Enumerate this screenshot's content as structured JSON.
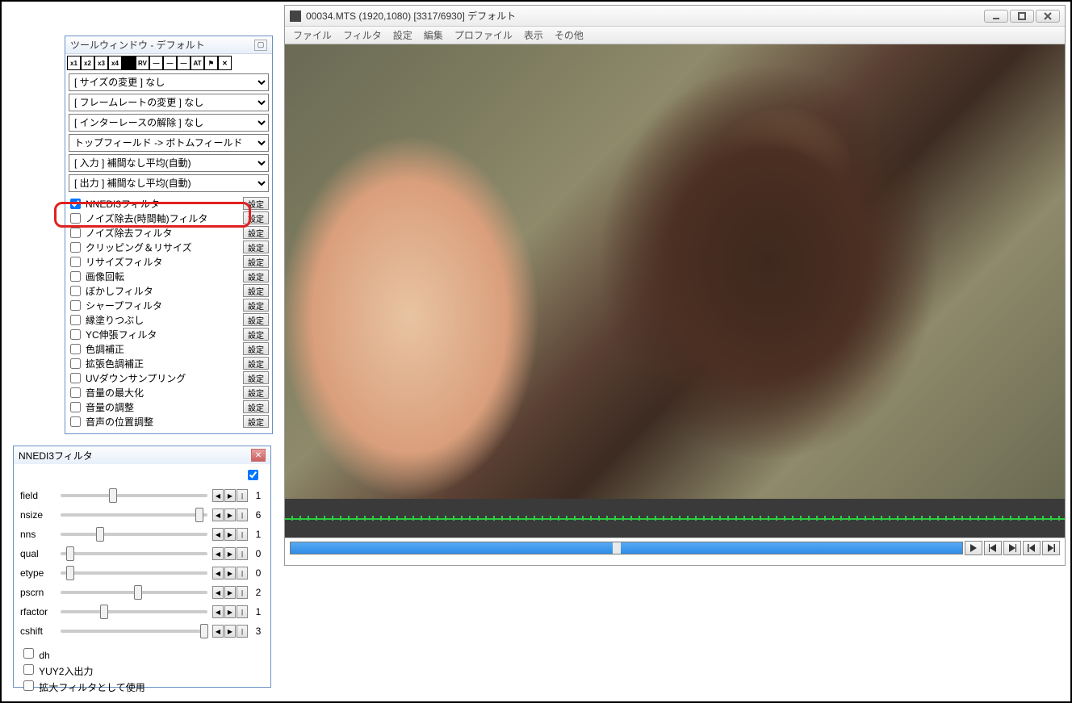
{
  "main": {
    "title": "00034.MTS (1920,1080) [3317/6930] デフォルト",
    "menu": [
      "ファイル",
      "フィルタ",
      "設定",
      "編集",
      "プロファイル",
      "表示",
      "その他"
    ]
  },
  "toolWindow": {
    "title": "ツールウィンドウ - デフォルト",
    "toolbar": [
      "x1",
      "x2",
      "x3",
      "x4",
      "",
      "RV",
      "—",
      "—",
      "—",
      "AT",
      "⚑",
      "✕"
    ],
    "selects": [
      {
        "value": "[ サイズの変更 ] なし"
      },
      {
        "value": "[ フレームレートの変更 ] なし"
      },
      {
        "value": "[ インターレースの解除 ] なし"
      },
      {
        "value": "トップフィールド -> ボトムフィールド"
      },
      {
        "value": "[ 入力 ] 補間なし平均(自動)"
      },
      {
        "value": "[ 出力 ] 補間なし平均(自動)"
      }
    ],
    "settings_label": "設定",
    "filters": [
      {
        "label": "NNEDI3フィルタ",
        "checked": true
      },
      {
        "label": "ノイズ除去(時間軸)フィルタ",
        "checked": false
      },
      {
        "label": "ノイズ除去フィルタ",
        "checked": false
      },
      {
        "label": "クリッピング＆リサイズ",
        "checked": false
      },
      {
        "label": "リサイズフィルタ",
        "checked": false
      },
      {
        "label": "画像回転",
        "checked": false
      },
      {
        "label": "ぼかしフィルタ",
        "checked": false
      },
      {
        "label": "シャープフィルタ",
        "checked": false
      },
      {
        "label": "縁塗りつぶし",
        "checked": false
      },
      {
        "label": "YC伸張フィルタ",
        "checked": false
      },
      {
        "label": "色調補正",
        "checked": false
      },
      {
        "label": "拡張色調補正",
        "checked": false
      },
      {
        "label": "UVダウンサンプリング",
        "checked": false
      },
      {
        "label": "音量の最大化",
        "checked": false
      },
      {
        "label": "音量の調整",
        "checked": false
      },
      {
        "label": "音声の位置調整",
        "checked": false
      }
    ]
  },
  "nnedi": {
    "title": "NNEDI3フィルタ",
    "sliders": [
      {
        "name": "field",
        "value": 1,
        "pos": 33
      },
      {
        "name": "nsize",
        "value": 6,
        "pos": 92
      },
      {
        "name": "nns",
        "value": 1,
        "pos": 24
      },
      {
        "name": "qual",
        "value": 0,
        "pos": 4
      },
      {
        "name": "etype",
        "value": 0,
        "pos": 4
      },
      {
        "name": "pscrn",
        "value": 2,
        "pos": 50
      },
      {
        "name": "rfactor",
        "value": 1,
        "pos": 27
      },
      {
        "name": "cshift",
        "value": 3,
        "pos": 95
      }
    ],
    "checks": [
      {
        "label": "dh",
        "checked": false
      },
      {
        "label": "YUY2入出力",
        "checked": false
      },
      {
        "label": "拡大フィルタとして使用",
        "checked": false
      }
    ]
  }
}
